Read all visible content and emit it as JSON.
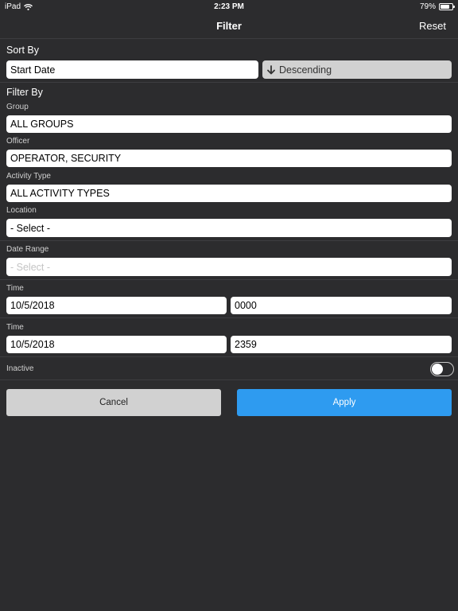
{
  "status_bar": {
    "device": "iPad",
    "time": "2:23 PM",
    "battery": "79%",
    "battery_level": 0.79,
    "wifi_icon": "wifi-icon",
    "battery_icon": "battery-icon"
  },
  "nav": {
    "title": "Filter",
    "reset_label": "Reset"
  },
  "sort": {
    "title": "Sort By",
    "field_value": "Start Date",
    "direction_label": "Descending",
    "direction_icon": "arrow-down-icon"
  },
  "filter": {
    "title": "Filter By",
    "group_label": "Group",
    "group_value": "ALL GROUPS",
    "officer_label": "Officer",
    "officer_value": "OPERATOR, SECURITY",
    "activity_label": "Activity Type",
    "activity_value": "ALL ACTIVITY TYPES",
    "location_label": "Location",
    "location_value": "- Select -",
    "date_range_label": "Date Range",
    "date_range_placeholder": "- Select -",
    "start_time_label": "Time",
    "start_date": "10/5/2018",
    "start_time": "0000",
    "end_time_label": "Time",
    "end_date": "10/5/2018",
    "end_time": "2359",
    "inactive_label": "Inactive",
    "inactive_on": false
  },
  "actions": {
    "cancel_label": "Cancel",
    "apply_label": "Apply"
  },
  "colors": {
    "background": "#2c2c2e",
    "apply": "#2e9bf0",
    "secondary_button": "#d1d1d1"
  }
}
